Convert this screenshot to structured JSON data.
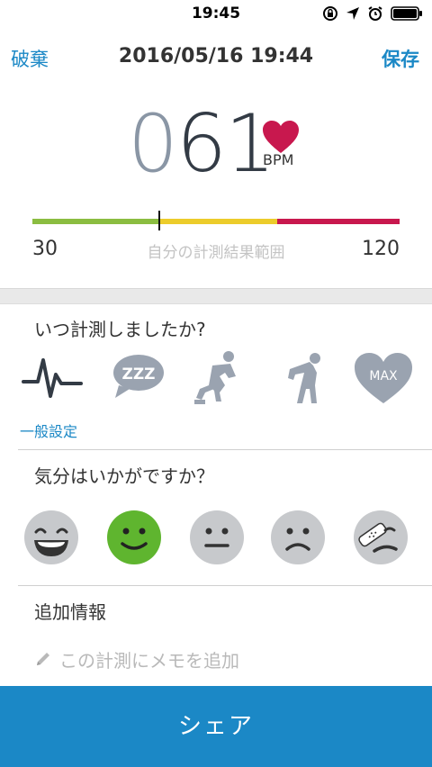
{
  "status_bar": {
    "time": "19:45"
  },
  "nav": {
    "cancel": "破棄",
    "title": "2016/05/16 19:44",
    "save": "保存"
  },
  "measurement": {
    "bpm_lead": "0",
    "bpm_rest": "61",
    "unit": "BPM",
    "heart_color": "#c8184e"
  },
  "range": {
    "min": "30",
    "max": "120",
    "label": "自分の計測結果範囲",
    "value": 61
  },
  "when": {
    "question": "いつ計測しましたか?",
    "options": [
      "general-pulse",
      "sleep",
      "before-exercise",
      "after-exercise",
      "max-heart"
    ],
    "max_label": "MAX",
    "sleep_label": "ZZZ",
    "selected_label": "一般設定"
  },
  "mood": {
    "question": "気分はいかがですか？",
    "options": [
      "very-happy",
      "happy",
      "neutral",
      "sad",
      "hurt"
    ],
    "selected_color": "#5fb52f"
  },
  "notes": {
    "heading": "追加情報",
    "placeholder": "この計測にメモを追加"
  },
  "share": {
    "label": "シェア"
  }
}
